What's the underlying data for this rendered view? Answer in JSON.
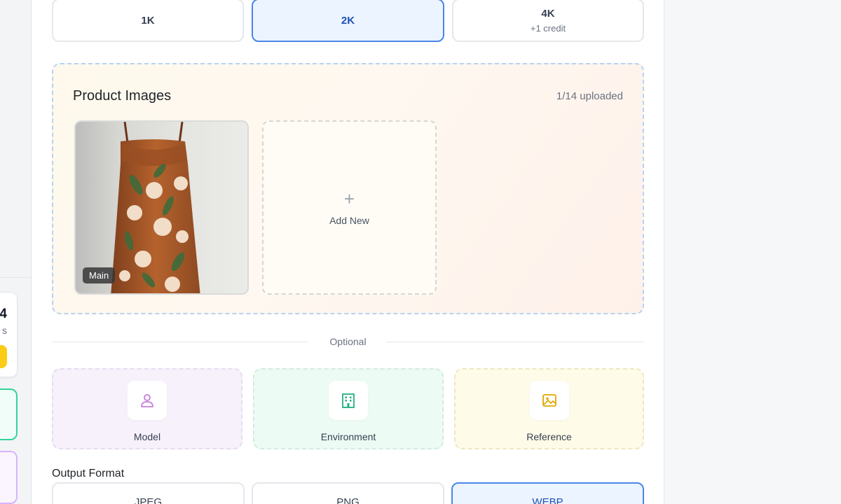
{
  "sidebar_peek": {
    "credit_number": "4",
    "credit_suffix": "s"
  },
  "resolution": {
    "options": [
      {
        "label": "1K",
        "sub": ""
      },
      {
        "label": "2K",
        "sub": ""
      },
      {
        "label": "4K",
        "sub": "+1 credit"
      }
    ],
    "selected": "2K"
  },
  "product_images": {
    "title": "Product Images",
    "count": "1/14 uploaded",
    "main_badge": "Main",
    "add_new_label": "Add New",
    "add_new_icon": "plus-icon"
  },
  "optional": {
    "divider_label": "Optional",
    "cards": [
      {
        "label": "Model",
        "icon": "person-icon",
        "color": "#c77dde"
      },
      {
        "label": "Environment",
        "icon": "building-icon",
        "color": "#22b07d"
      },
      {
        "label": "Reference",
        "icon": "image-icon",
        "color": "#e0a800"
      }
    ]
  },
  "output_format": {
    "title": "Output Format",
    "options": [
      "JPEG",
      "PNG",
      "WEBP"
    ],
    "selected": "WEBP"
  },
  "colors": {
    "accent_blue": "#4a86e8",
    "selected_bg": "#ecf4ff",
    "credit_yellow": "#facc15",
    "green_border": "#34d399",
    "purple_border": "#d8b4fe"
  }
}
